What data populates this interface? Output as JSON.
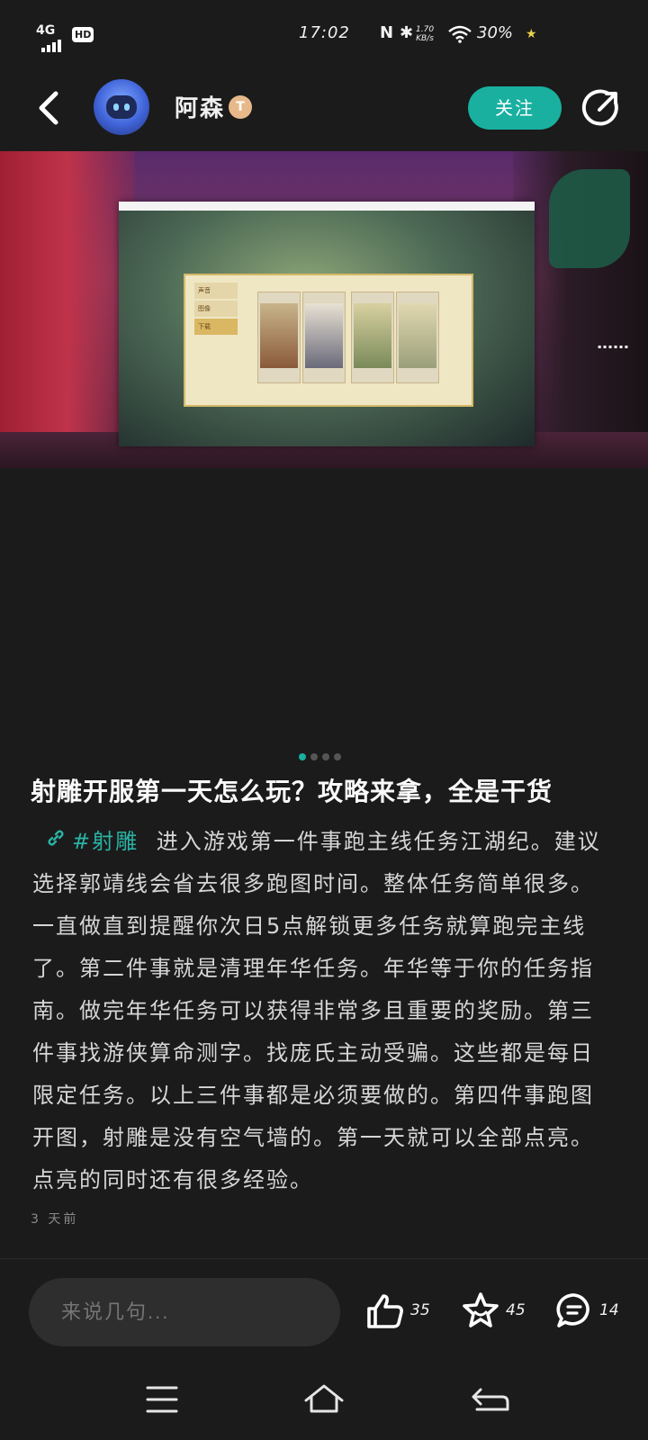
{
  "status_bar": {
    "network": "4G",
    "hd": "HD",
    "time": "17:02",
    "nfc": "N",
    "speed_value": "1.70",
    "speed_unit": "KB/s",
    "battery": "30%"
  },
  "header": {
    "username": "阿森",
    "level_badge": "T",
    "follow_label": "关注"
  },
  "carousel": {
    "slide_count": 4,
    "active_index": 0,
    "menu_items": [
      "声音",
      "图像",
      "下载"
    ]
  },
  "post": {
    "title": "射雕开服第一天怎么玩？攻略来拿，全是干货",
    "tag": "#射雕",
    "body": "进入游戏第一件事跑主线任务江湖纪。建议选择郭靖线会省去很多跑图时间。整体任务简单很多。一直做直到提醒你次日5点解锁更多任务就算跑完主线了。第二件事就是清理年华任务。年华等于你的任务指南。做完年华任务可以获得非常多且重要的奖励。第三件事找游侠算命测字。找庞氏主动受骗。这些都是每日限定任务。以上三件事都是必须要做的。第四件事跑图开图，射雕是没有空气墙的。第一天就可以全部点亮。点亮的同时还有很多经验。",
    "time": "3 天前"
  },
  "actions": {
    "comment_placeholder": "来说几句...",
    "like_count": "35",
    "favorite_count": "45",
    "comment_count": "14"
  },
  "colors": {
    "accent": "#19b0a0",
    "background": "#1b1b1b"
  }
}
